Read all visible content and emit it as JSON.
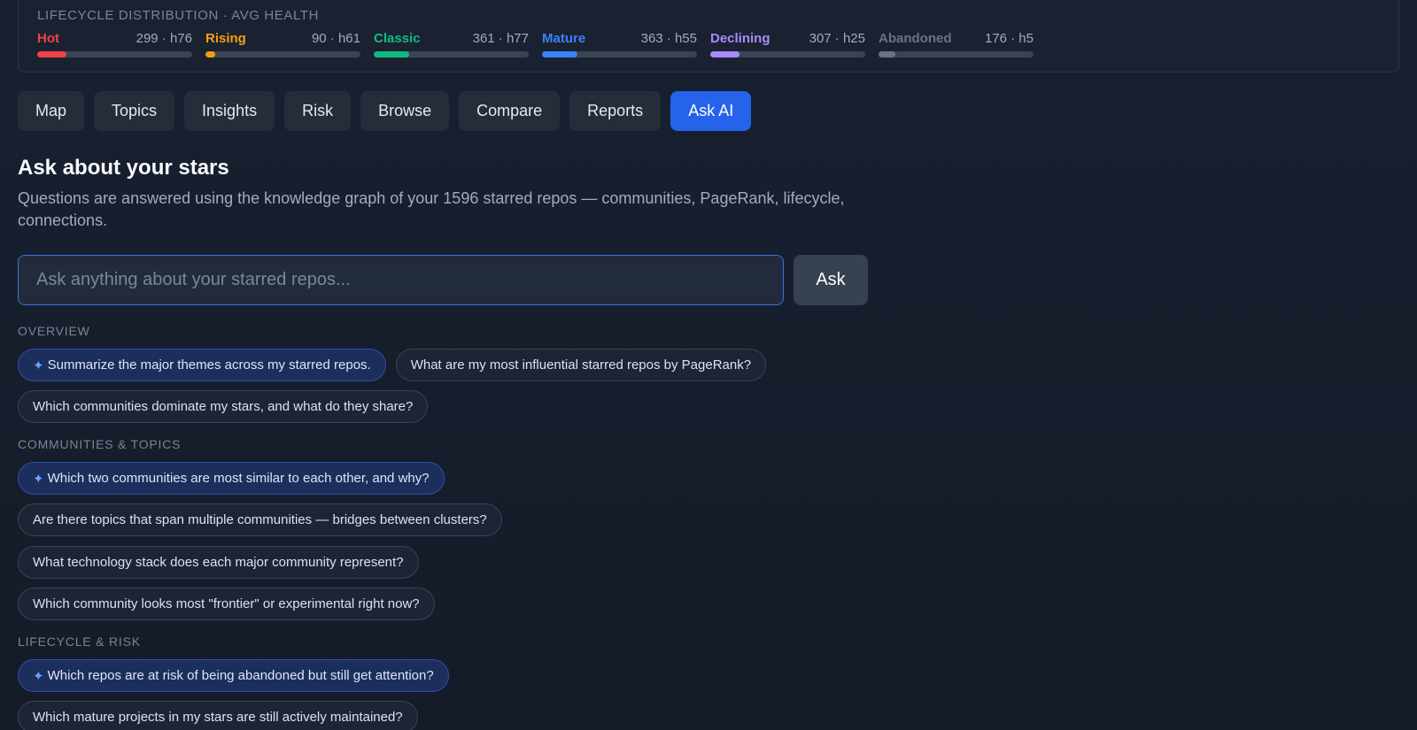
{
  "lifecycle": {
    "heading": "LIFECYCLE DISTRIBUTION · AVG HEALTH",
    "items": [
      {
        "name": "Hot",
        "stat": "299 · h76",
        "color": "#ef4444",
        "fill": 0.19
      },
      {
        "name": "Rising",
        "stat": "90 · h61",
        "color": "#f59e0b",
        "fill": 0.06
      },
      {
        "name": "Classic",
        "stat": "361 · h77",
        "color": "#10b981",
        "fill": 0.23
      },
      {
        "name": "Mature",
        "stat": "363 · h55",
        "color": "#3b82f6",
        "fill": 0.23
      },
      {
        "name": "Declining",
        "stat": "307 · h25",
        "color": "#a78bfa",
        "fill": 0.19
      },
      {
        "name": "Abandoned",
        "stat": "176 · h5",
        "color": "#6b7280",
        "fill": 0.11
      }
    ]
  },
  "nav": {
    "tabs": [
      {
        "label": "Map",
        "active": false
      },
      {
        "label": "Topics",
        "active": false
      },
      {
        "label": "Insights",
        "active": false
      },
      {
        "label": "Risk",
        "active": false
      },
      {
        "label": "Browse",
        "active": false
      },
      {
        "label": "Compare",
        "active": false
      },
      {
        "label": "Reports",
        "active": false
      },
      {
        "label": "Ask AI",
        "active": true
      }
    ]
  },
  "main": {
    "title": "Ask about your stars",
    "description": "Questions are answered using the knowledge graph of your 1596 starred repos — communities, PageRank, lifecycle, connections.",
    "input_placeholder": "Ask anything about your starred repos...",
    "ask_label": "Ask"
  },
  "suggestions": {
    "sparkle_glyph": "✦",
    "overview": {
      "label": "OVERVIEW",
      "chips": [
        {
          "text": "Summarize the major themes across my starred repos.",
          "featured": true
        },
        {
          "text": "What are my most influential starred repos by PageRank?",
          "featured": false
        },
        {
          "text": "Which communities dominate my stars, and what do they share?",
          "featured": false
        }
      ]
    },
    "communities": {
      "label": "COMMUNITIES & TOPICS",
      "chips": [
        {
          "text": "Which two communities are most similar to each other, and why?",
          "featured": true
        },
        {
          "text": "Are there topics that span multiple communities — bridges between clusters?",
          "featured": false
        },
        {
          "text": "What technology stack does each major community represent?",
          "featured": false
        },
        {
          "text": "Which community looks most \"frontier\" or experimental right now?",
          "featured": false
        }
      ]
    },
    "lifecycle_risk": {
      "label": "LIFECYCLE & RISK",
      "chips": [
        {
          "text": "Which repos are at risk of being abandoned but still get attention?",
          "featured": true
        },
        {
          "text": "Which mature projects in my stars are still actively maintained?",
          "featured": false
        }
      ]
    }
  }
}
